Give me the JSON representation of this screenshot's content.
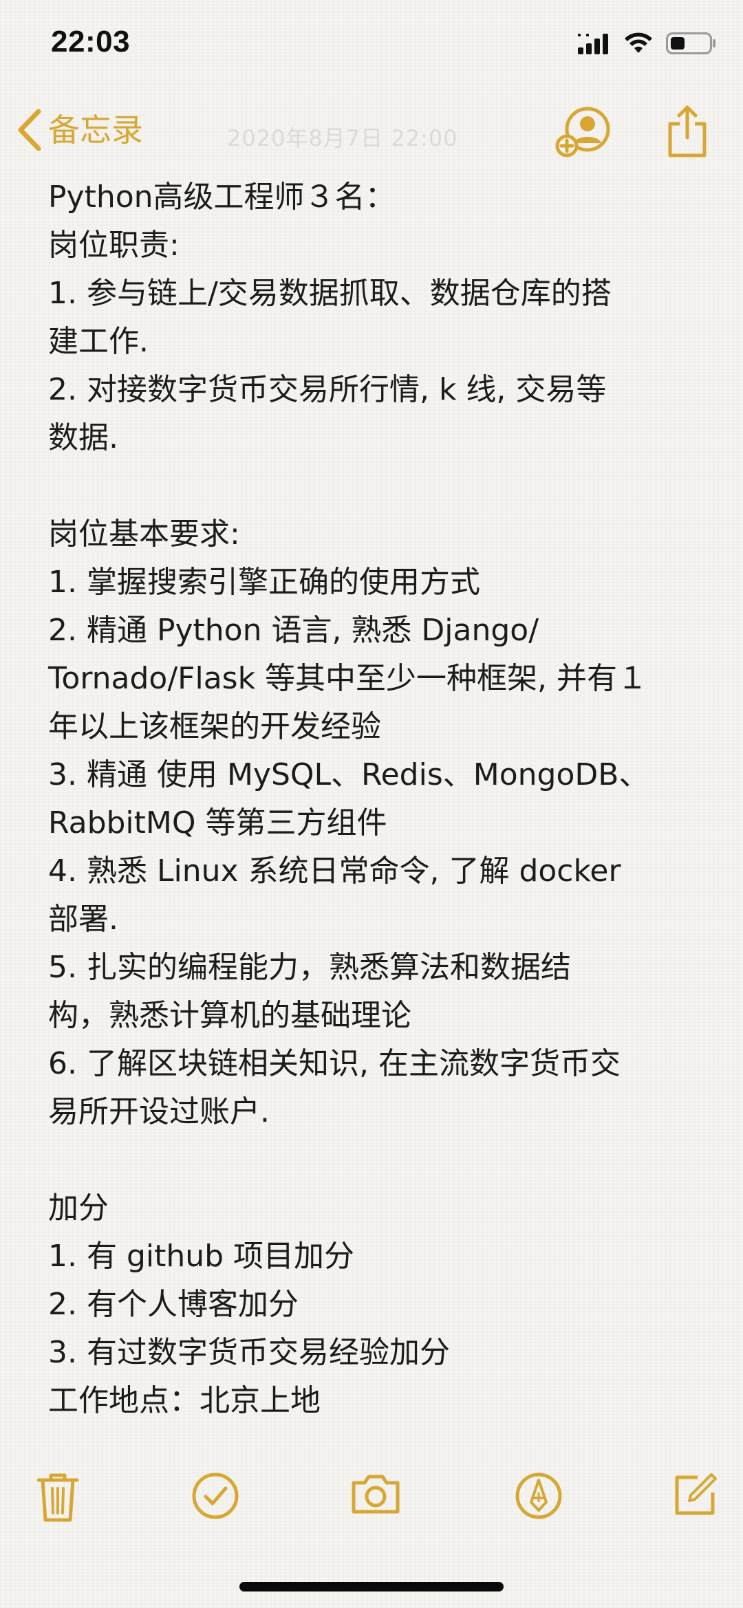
{
  "status_bar": {
    "time": "22:03"
  },
  "nav": {
    "back_label": "备忘录",
    "faded_date": "2020年8月7日 22:00"
  },
  "note": {
    "lines": [
      "Python高级工程师３名：",
      "岗位职责:",
      "1. 参与链上/交易数据抓取、数据仓库的搭",
      "建工作.",
      "2. 对接数字货币交易所行情, k 线, 交易等",
      "数据.",
      "",
      "岗位基本要求:",
      "1. 掌握搜索引擎正确的使用方式",
      "2. 精通 Python 语言, 熟悉 Django/",
      "Tornado/Flask 等其中至少一种框架, 并有１",
      "年以上该框架的开发经验",
      "3. 精通 使用 MySQL、Redis、MongoDB、",
      "RabbitMQ 等第三方组件",
      "4. 熟悉 Linux 系统日常命令, 了解 docker",
      "部署.",
      "5. 扎实的编程能力，熟悉算法和数据结",
      "构，熟悉计算机的基础理论",
      "6. 了解区块链相关知识, 在主流数字货币交",
      "易所开设过账户.",
      "",
      "加分",
      "1. 有 github 项目加分",
      "2. 有个人博客加分",
      "3. 有过数字货币交易经验加分",
      "工作地点：北京上地"
    ]
  },
  "colors": {
    "accent": "#d8a733",
    "text": "#1c1c1c",
    "background": "#f5f4f1"
  },
  "icons": {
    "back": "chevron-left-icon",
    "collaborate": "add-person-icon",
    "share": "share-icon",
    "delete": "trash-icon",
    "checklist": "checkmark-circle-icon",
    "camera": "camera-icon",
    "markup": "pen-circle-icon",
    "compose": "compose-icon"
  }
}
